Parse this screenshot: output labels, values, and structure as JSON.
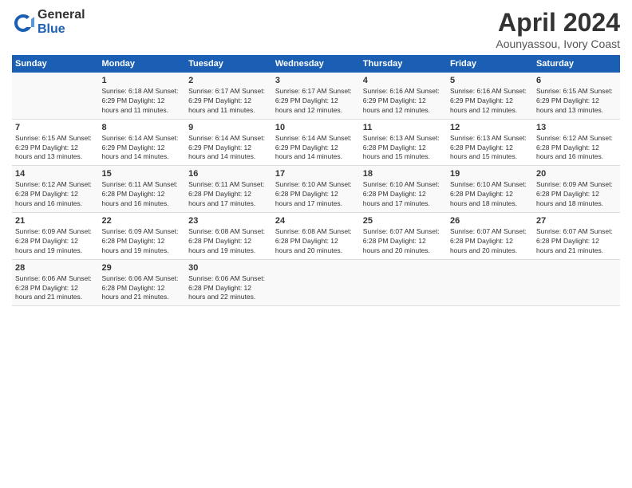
{
  "logo": {
    "general": "General",
    "blue": "Blue"
  },
  "title": {
    "month": "April 2024",
    "location": "Aounyassou, Ivory Coast"
  },
  "header_days": [
    "Sunday",
    "Monday",
    "Tuesday",
    "Wednesday",
    "Thursday",
    "Friday",
    "Saturday"
  ],
  "weeks": [
    [
      {
        "num": "",
        "info": ""
      },
      {
        "num": "1",
        "info": "Sunrise: 6:18 AM\nSunset: 6:29 PM\nDaylight: 12 hours\nand 11 minutes."
      },
      {
        "num": "2",
        "info": "Sunrise: 6:17 AM\nSunset: 6:29 PM\nDaylight: 12 hours\nand 11 minutes."
      },
      {
        "num": "3",
        "info": "Sunrise: 6:17 AM\nSunset: 6:29 PM\nDaylight: 12 hours\nand 12 minutes."
      },
      {
        "num": "4",
        "info": "Sunrise: 6:16 AM\nSunset: 6:29 PM\nDaylight: 12 hours\nand 12 minutes."
      },
      {
        "num": "5",
        "info": "Sunrise: 6:16 AM\nSunset: 6:29 PM\nDaylight: 12 hours\nand 12 minutes."
      },
      {
        "num": "6",
        "info": "Sunrise: 6:15 AM\nSunset: 6:29 PM\nDaylight: 12 hours\nand 13 minutes."
      }
    ],
    [
      {
        "num": "7",
        "info": "Sunrise: 6:15 AM\nSunset: 6:29 PM\nDaylight: 12 hours\nand 13 minutes."
      },
      {
        "num": "8",
        "info": "Sunrise: 6:14 AM\nSunset: 6:29 PM\nDaylight: 12 hours\nand 14 minutes."
      },
      {
        "num": "9",
        "info": "Sunrise: 6:14 AM\nSunset: 6:29 PM\nDaylight: 12 hours\nand 14 minutes."
      },
      {
        "num": "10",
        "info": "Sunrise: 6:14 AM\nSunset: 6:29 PM\nDaylight: 12 hours\nand 14 minutes."
      },
      {
        "num": "11",
        "info": "Sunrise: 6:13 AM\nSunset: 6:28 PM\nDaylight: 12 hours\nand 15 minutes."
      },
      {
        "num": "12",
        "info": "Sunrise: 6:13 AM\nSunset: 6:28 PM\nDaylight: 12 hours\nand 15 minutes."
      },
      {
        "num": "13",
        "info": "Sunrise: 6:12 AM\nSunset: 6:28 PM\nDaylight: 12 hours\nand 16 minutes."
      }
    ],
    [
      {
        "num": "14",
        "info": "Sunrise: 6:12 AM\nSunset: 6:28 PM\nDaylight: 12 hours\nand 16 minutes."
      },
      {
        "num": "15",
        "info": "Sunrise: 6:11 AM\nSunset: 6:28 PM\nDaylight: 12 hours\nand 16 minutes."
      },
      {
        "num": "16",
        "info": "Sunrise: 6:11 AM\nSunset: 6:28 PM\nDaylight: 12 hours\nand 17 minutes."
      },
      {
        "num": "17",
        "info": "Sunrise: 6:10 AM\nSunset: 6:28 PM\nDaylight: 12 hours\nand 17 minutes."
      },
      {
        "num": "18",
        "info": "Sunrise: 6:10 AM\nSunset: 6:28 PM\nDaylight: 12 hours\nand 17 minutes."
      },
      {
        "num": "19",
        "info": "Sunrise: 6:10 AM\nSunset: 6:28 PM\nDaylight: 12 hours\nand 18 minutes."
      },
      {
        "num": "20",
        "info": "Sunrise: 6:09 AM\nSunset: 6:28 PM\nDaylight: 12 hours\nand 18 minutes."
      }
    ],
    [
      {
        "num": "21",
        "info": "Sunrise: 6:09 AM\nSunset: 6:28 PM\nDaylight: 12 hours\nand 19 minutes."
      },
      {
        "num": "22",
        "info": "Sunrise: 6:09 AM\nSunset: 6:28 PM\nDaylight: 12 hours\nand 19 minutes."
      },
      {
        "num": "23",
        "info": "Sunrise: 6:08 AM\nSunset: 6:28 PM\nDaylight: 12 hours\nand 19 minutes."
      },
      {
        "num": "24",
        "info": "Sunrise: 6:08 AM\nSunset: 6:28 PM\nDaylight: 12 hours\nand 20 minutes."
      },
      {
        "num": "25",
        "info": "Sunrise: 6:07 AM\nSunset: 6:28 PM\nDaylight: 12 hours\nand 20 minutes."
      },
      {
        "num": "26",
        "info": "Sunrise: 6:07 AM\nSunset: 6:28 PM\nDaylight: 12 hours\nand 20 minutes."
      },
      {
        "num": "27",
        "info": "Sunrise: 6:07 AM\nSunset: 6:28 PM\nDaylight: 12 hours\nand 21 minutes."
      }
    ],
    [
      {
        "num": "28",
        "info": "Sunrise: 6:06 AM\nSunset: 6:28 PM\nDaylight: 12 hours\nand 21 minutes."
      },
      {
        "num": "29",
        "info": "Sunrise: 6:06 AM\nSunset: 6:28 PM\nDaylight: 12 hours\nand 21 minutes."
      },
      {
        "num": "30",
        "info": "Sunrise: 6:06 AM\nSunset: 6:28 PM\nDaylight: 12 hours\nand 22 minutes."
      },
      {
        "num": "",
        "info": ""
      },
      {
        "num": "",
        "info": ""
      },
      {
        "num": "",
        "info": ""
      },
      {
        "num": "",
        "info": ""
      }
    ]
  ]
}
